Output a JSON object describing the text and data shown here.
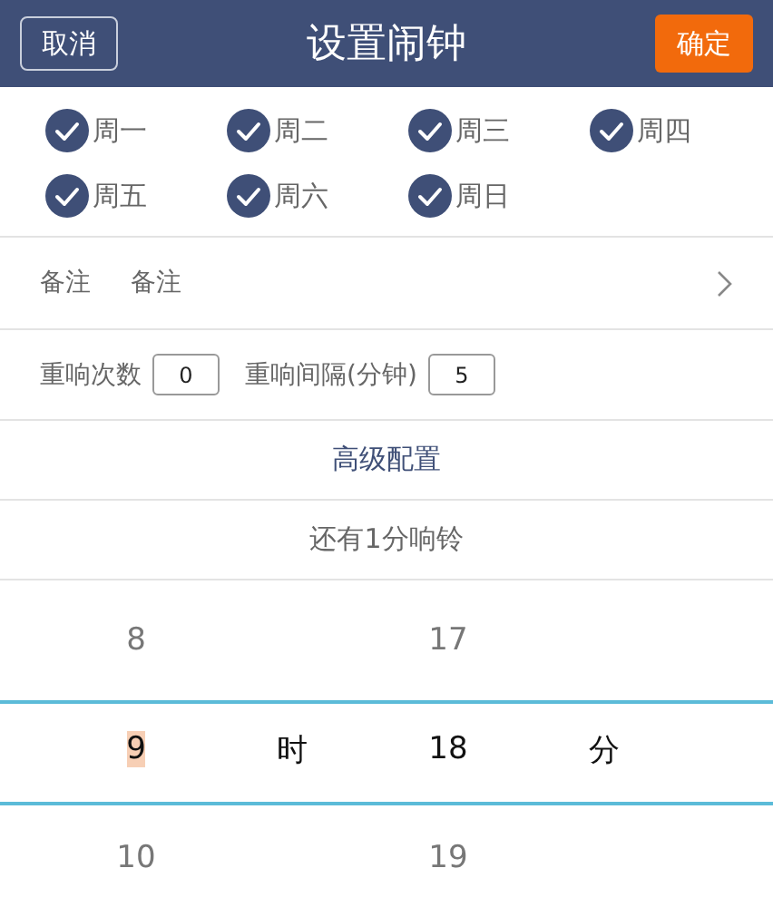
{
  "header": {
    "cancel": "取消",
    "title": "设置闹钟",
    "confirm": "确定"
  },
  "days": [
    {
      "label": "周一",
      "checked": true
    },
    {
      "label": "周二",
      "checked": true
    },
    {
      "label": "周三",
      "checked": true
    },
    {
      "label": "周四",
      "checked": true
    },
    {
      "label": "周五",
      "checked": true
    },
    {
      "label": "周六",
      "checked": true
    },
    {
      "label": "周日",
      "checked": true
    }
  ],
  "note": {
    "label": "备注",
    "value": "备注"
  },
  "snooze": {
    "count_label": "重响次数",
    "count": "0",
    "interval_label": "重响间隔(分钟)",
    "interval": "5"
  },
  "advanced": "高级配置",
  "remaining": "还有1分响铃",
  "picker": {
    "hour": {
      "above": "8",
      "value": "9",
      "below": "10",
      "highlighted": true,
      "unit": "时"
    },
    "minute": {
      "above": "17",
      "value": "18",
      "below": "19",
      "highlighted": false,
      "unit": "分"
    }
  }
}
